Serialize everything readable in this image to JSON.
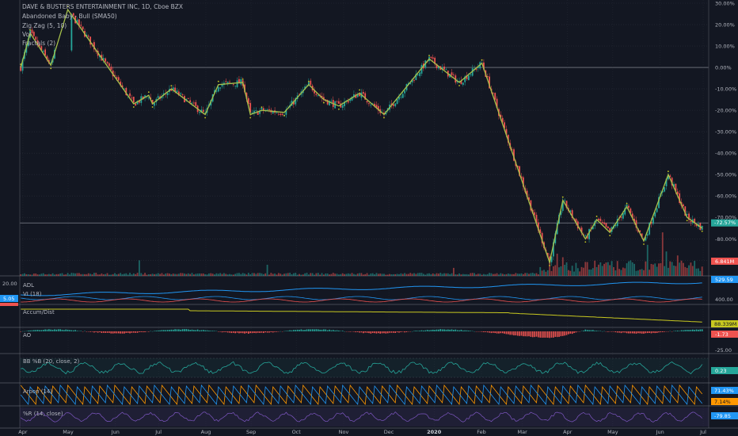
{
  "colors": {
    "background": "#131722",
    "grid": "#2a2e39",
    "text": "#b2b5be",
    "up": "#26a69a",
    "down": "#ef5350",
    "zigzag": "#a7c24a",
    "adl": "#2196f3",
    "vi_plus": "#2196f3",
    "vi_minus": "#ef5350",
    "accum": "#c8c820",
    "bb": "#26a69a",
    "aroon_up": "#ff9800",
    "aroon_down": "#2196f3",
    "wr": "#7e57c2",
    "fractal": "#c8c820"
  },
  "legend": {
    "title": "DAVE & BUSTERS ENTERTAINMENT INC, 1D, Cboe BZX",
    "lines": [
      "Abandoned Baby - Bull (SMA50)",
      "Zig Zag (5, 10)",
      "Vol",
      "Fractals (2)"
    ]
  },
  "pane_labels": {
    "adl": "ADL",
    "vi": "VI (18)",
    "accum": "Accum/Dist",
    "ao": "AO",
    "bb": "BB %B (20, close, 2)",
    "aroon": "Aroon (14)",
    "wr": "%R (14, close)"
  },
  "scale_labels": {
    "adl_top": "20.00",
    "vi_left_value": "5.05",
    "adl_right_value": "529.59",
    "adl_right_tick": "400.00",
    "accum_value": "88.339M",
    "ao_value": "-1.73",
    "ao_tick": "-25.00",
    "bb_value": "0.23",
    "aroon_up_value": "71.43%",
    "aroon_down_value": "7.14%",
    "wr_value": "-79.85",
    "volume_value": "6.841M"
  },
  "chart_data": {
    "type": "candlestick",
    "title": "DAVE & BUSTERS ENTERTAINMENT INC, 1D, Cboe BZX",
    "y_unit": "percent change",
    "ylim": [
      -91,
      30
    ],
    "y_ticks": [
      30,
      20,
      10,
      0,
      -10,
      -20,
      -30,
      -40,
      -50,
      -60,
      -70,
      -80,
      -90
    ],
    "y_tick_labels": [
      "30.00%",
      "20.00%",
      "10.00%",
      "0.00%",
      "-10.00%",
      "-20.00%",
      "-30.00%",
      "-40.00%",
      "-50.00%",
      "-60.00%",
      "-70.00%",
      "-80.00%",
      "-90.00%"
    ],
    "x_ticks": [
      "Apr",
      "May",
      "Jun",
      "Jul",
      "Aug",
      "Sep",
      "Oct",
      "Nov",
      "Dec",
      "2020",
      "Feb",
      "Mar",
      "Apr",
      "May",
      "Jun",
      "Jul"
    ],
    "x_tick_index": [
      1,
      22,
      44,
      64,
      86,
      107,
      128,
      150,
      171,
      192,
      214,
      233,
      254,
      275,
      297,
      317
    ],
    "n_bars": 320,
    "last_value": -72.57,
    "last_value_label": "-72.57%",
    "zigzag": [
      {
        "i": 0,
        "v": 0
      },
      {
        "i": 5,
        "v": 16
      },
      {
        "i": 16,
        "v": 1
      },
      {
        "i": 25,
        "v": 27
      },
      {
        "i": 60,
        "v": -17
      },
      {
        "i": 68,
        "v": -13
      },
      {
        "i": 70,
        "v": -17
      },
      {
        "i": 80,
        "v": -10
      },
      {
        "i": 98,
        "v": -22
      },
      {
        "i": 105,
        "v": -8
      },
      {
        "i": 118,
        "v": -7
      },
      {
        "i": 122,
        "v": -22
      },
      {
        "i": 128,
        "v": -20
      },
      {
        "i": 140,
        "v": -21
      },
      {
        "i": 153,
        "v": -8
      },
      {
        "i": 161,
        "v": -15
      },
      {
        "i": 169,
        "v": -18
      },
      {
        "i": 180,
        "v": -12
      },
      {
        "i": 193,
        "v": -22
      },
      {
        "i": 217,
        "v": 4
      },
      {
        "i": 233,
        "v": -7
      },
      {
        "i": 245,
        "v": 2
      },
      {
        "i": 281,
        "v": -91
      },
      {
        "i": 288,
        "v": -62
      },
      {
        "i": 300,
        "v": -80
      },
      {
        "i": 306,
        "v": -71
      },
      {
        "i": 313,
        "v": -77
      },
      {
        "i": 322,
        "v": -65
      },
      {
        "i": 331,
        "v": -81
      },
      {
        "i": 344,
        "v": -50
      },
      {
        "i": 354,
        "v": -70
      },
      {
        "i": 362,
        "v": -75
      }
    ],
    "volume_spikes": [
      {
        "i": 63,
        "v": 3.5
      },
      {
        "i": 131,
        "v": 2.5
      },
      {
        "i": 230,
        "v": 1.8
      },
      {
        "i": 285,
        "v": 5.0
      },
      {
        "i": 288,
        "v": 4.2
      },
      {
        "i": 333,
        "v": 7.0
      },
      {
        "i": 341,
        "v": 9.8
      },
      {
        "i": 343,
        "v": 5.5
      },
      {
        "i": 349,
        "v": 4.6
      }
    ]
  }
}
